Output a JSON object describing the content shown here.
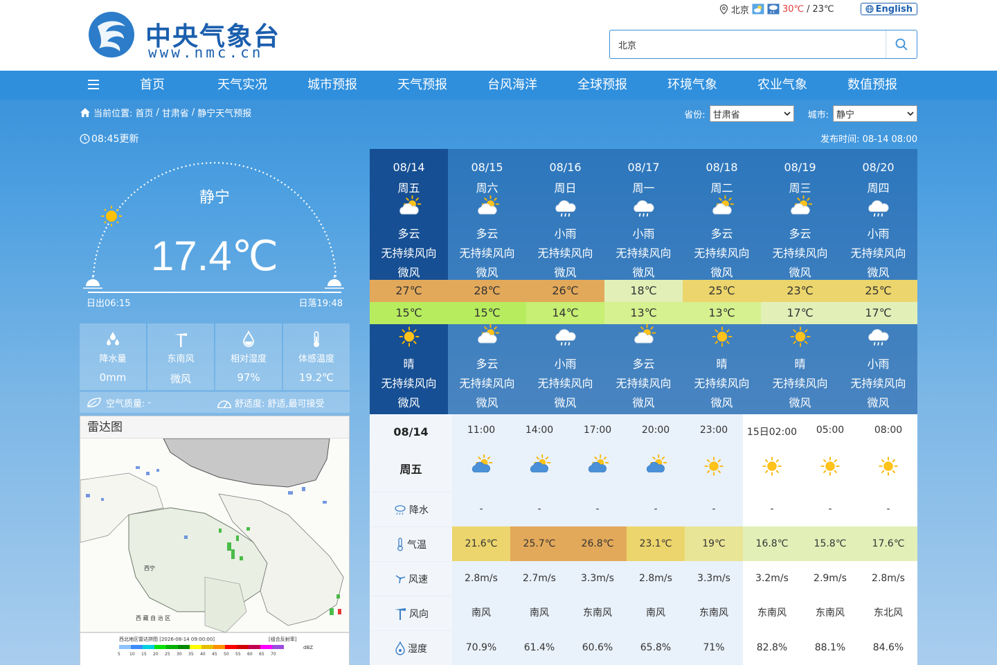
{
  "header": {
    "logo_text": "中央气象台",
    "logo_url": "www.nmc.cn",
    "top_city": "北京",
    "top_temp_high": "30℃",
    "top_temp_sep": "/",
    "top_temp_low": "23℃",
    "lang_label": "English",
    "search_value": "北京"
  },
  "nav": {
    "items": [
      "首页",
      "天气实况",
      "城市预报",
      "天气预报",
      "台风海洋",
      "全球预报",
      "环境气象",
      "农业气象",
      "数值预报"
    ]
  },
  "breadcrumb": {
    "prefix": "当前位置:",
    "items": [
      "首页",
      "甘肃省",
      "静宁天气预报"
    ],
    "sep": "/"
  },
  "selectors": {
    "province_label": "省份:",
    "province_value": "甘肃省",
    "city_label": "城市:",
    "city_value": "静宁"
  },
  "update_text": "08:45更新",
  "publish": {
    "label": "发布时间:",
    "value": "08-14 08:00"
  },
  "current": {
    "city": "静宁",
    "temperature": "17.4℃",
    "sunrise": "日出06:15",
    "sunset": "日落19:48"
  },
  "stats": [
    {
      "icon": "raindrops-icon",
      "label": "降水量",
      "value": "0mm"
    },
    {
      "icon": "wind-turbine-icon",
      "label": "东南风",
      "value": "微风"
    },
    {
      "icon": "humidity-drop-icon",
      "label": "相对湿度",
      "value": "97%"
    },
    {
      "icon": "thermometer-icon",
      "label": "体感温度",
      "value": "19.2℃"
    }
  ],
  "air": {
    "label": "空气质量:",
    "value": "-",
    "comfort_label": "舒适度:",
    "comfort_value": "舒适,最可接受"
  },
  "radar": {
    "title": "雷达图",
    "caption": "西北地区雷达拼图 [2026-08-14 09:00:00]",
    "tag": "[组合反射率]",
    "scale": [
      "5",
      "10",
      "15",
      "20",
      "25",
      "30",
      "35",
      "40",
      "45",
      "50",
      "55",
      "60",
      "65",
      "70"
    ],
    "unit": "dBZ",
    "region_label": "西 藏 自 治 区",
    "city_label": "西宁"
  },
  "forecast": [
    {
      "date": "08/14",
      "week": "周五",
      "day_icon": "partly-cloudy-icon",
      "day_weather": "多云",
      "day_wind_dir": "无持续风向",
      "day_wind": "微风",
      "high": "27℃",
      "low": "15℃",
      "night_icon": "sunny-icon",
      "night_weather": "晴",
      "night_wind_dir": "无持续风向",
      "night_wind": "微风",
      "high_color": "#e3a95a",
      "low_color": "#b7ec5e"
    },
    {
      "date": "08/15",
      "week": "周六",
      "day_icon": "partly-cloudy-icon",
      "day_weather": "多云",
      "day_wind_dir": "无持续风向",
      "day_wind": "微风",
      "high": "28℃",
      "low": "15℃",
      "night_icon": "partly-cloudy-icon",
      "night_weather": "多云",
      "night_wind_dir": "无持续风向",
      "night_wind": "微风",
      "high_color": "#e3a95a",
      "low_color": "#b7ec5e"
    },
    {
      "date": "08/16",
      "week": "周日",
      "day_icon": "light-rain-icon",
      "day_weather": "小雨",
      "day_wind_dir": "无持续风向",
      "day_wind": "微风",
      "high": "26℃",
      "low": "14℃",
      "night_icon": "light-rain-icon",
      "night_weather": "小雨",
      "night_wind_dir": "无持续风向",
      "night_wind": "微风",
      "high_color": "#e3a95a",
      "low_color": "#c6ef73"
    },
    {
      "date": "08/17",
      "week": "周一",
      "day_icon": "light-rain-icon",
      "day_weather": "小雨",
      "day_wind_dir": "无持续风向",
      "day_wind": "微风",
      "high": "18℃",
      "low": "13℃",
      "night_icon": "partly-cloudy-icon",
      "night_weather": "多云",
      "night_wind_dir": "无持续风向",
      "night_wind": "微风",
      "high_color": "#e2f0b8",
      "low_color": "#d6f18f"
    },
    {
      "date": "08/18",
      "week": "周二",
      "day_icon": "partly-cloudy-icon",
      "day_weather": "多云",
      "day_wind_dir": "无持续风向",
      "day_wind": "微风",
      "high": "25℃",
      "low": "13℃",
      "night_icon": "sunny-icon",
      "night_weather": "晴",
      "night_wind_dir": "无持续风向",
      "night_wind": "微风",
      "high_color": "#ecd56c",
      "low_color": "#d6f18f"
    },
    {
      "date": "08/19",
      "week": "周三",
      "day_icon": "partly-cloudy-icon",
      "day_weather": "多云",
      "day_wind_dir": "无持续风向",
      "day_wind": "微风",
      "high": "23℃",
      "low": "17℃",
      "night_icon": "sunny-icon",
      "night_weather": "晴",
      "night_wind_dir": "无持续风向",
      "night_wind": "微风",
      "high_color": "#ecd56c",
      "low_color": "#e2f0b8"
    },
    {
      "date": "08/20",
      "week": "周四",
      "day_icon": "light-rain-icon",
      "day_weather": "小雨",
      "day_wind_dir": "无持续风向",
      "day_wind": "微风",
      "high": "25℃",
      "low": "17℃",
      "night_icon": "light-rain-icon",
      "night_weather": "小雨",
      "night_wind_dir": "无持续风向",
      "night_wind": "微风",
      "high_color": "#ecd56c",
      "low_color": "#e2f0b8"
    }
  ],
  "hourly": {
    "date": "08/14",
    "week": "周五",
    "labels": {
      "rain": "降水",
      "temp": "气温",
      "speed": "风速",
      "dir": "风向",
      "humidity": "湿度"
    },
    "rows": [
      {
        "time": "11:00",
        "icon": "partly-cloudy-icon",
        "rain": "-",
        "temp": "21.6℃",
        "speed": "2.8m/s",
        "dir": "南风",
        "humidity": "70.9%",
        "temp_color": "#ecd56c"
      },
      {
        "time": "14:00",
        "icon": "partly-cloudy-icon",
        "rain": "-",
        "temp": "25.7℃",
        "speed": "2.7m/s",
        "dir": "南风",
        "humidity": "61.4%",
        "temp_color": "#e3a95a"
      },
      {
        "time": "17:00",
        "icon": "partly-cloudy-icon",
        "rain": "-",
        "temp": "26.8℃",
        "speed": "3.3m/s",
        "dir": "东南风",
        "humidity": "60.6%",
        "temp_color": "#e3a95a"
      },
      {
        "time": "20:00",
        "icon": "partly-cloudy-icon",
        "rain": "-",
        "temp": "23.1℃",
        "speed": "2.8m/s",
        "dir": "南风",
        "humidity": "65.8%",
        "temp_color": "#ecd56c"
      },
      {
        "time": "23:00",
        "icon": "sunny-icon",
        "rain": "-",
        "temp": "19℃",
        "speed": "3.3m/s",
        "dir": "东南风",
        "humidity": "71%",
        "temp_color": "#e9e596"
      },
      {
        "time": "15日02:00",
        "icon": "sunny-icon",
        "rain": "-",
        "temp": "16.8℃",
        "speed": "3.2m/s",
        "dir": "东南风",
        "humidity": "82.8%",
        "temp_color": "#e2f0b8"
      },
      {
        "time": "05:00",
        "icon": "sunny-icon",
        "rain": "-",
        "temp": "15.8℃",
        "speed": "2.9m/s",
        "dir": "东南风",
        "humidity": "88.1%",
        "temp_color": "#e2f0b8"
      },
      {
        "time": "08:00",
        "icon": "sunny-icon",
        "rain": "-",
        "temp": "17.6℃",
        "speed": "2.8m/s",
        "dir": "东北风",
        "humidity": "84.6%",
        "temp_color": "#e2f0b8"
      }
    ]
  }
}
